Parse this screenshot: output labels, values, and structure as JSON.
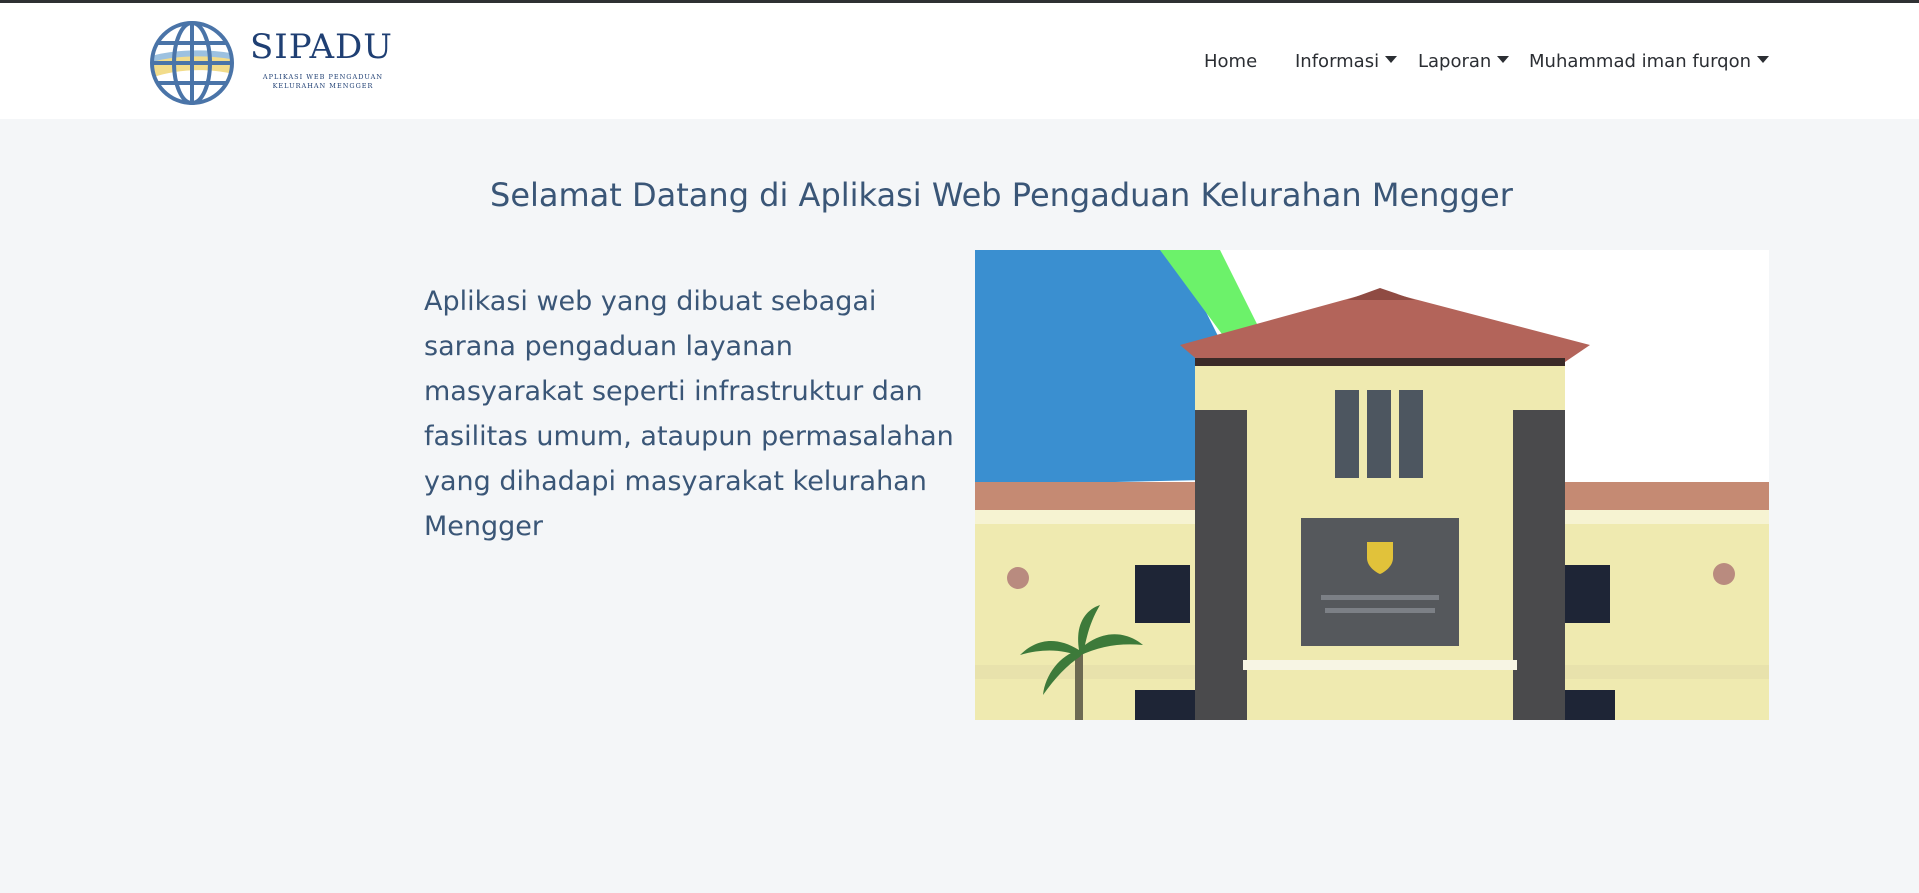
{
  "brand": {
    "title": "SIPADU",
    "subtitle": "APLIKASI WEB PENGADUAN KELURAHAN MENGGER",
    "colors": {
      "primary": "#1f3f73",
      "globe": "#4a74a8",
      "accent": "#f2dc8a"
    }
  },
  "nav": {
    "items": [
      {
        "label": "Home",
        "has_dropdown": false
      },
      {
        "label": "Informasi",
        "has_dropdown": true
      },
      {
        "label": "Laporan",
        "has_dropdown": true
      },
      {
        "label": "Muhammad iman furqon",
        "has_dropdown": true
      }
    ]
  },
  "main": {
    "title": "Selamat Datang di Aplikasi Web Pengaduan Kelurahan Mengger",
    "description": "Aplikasi web yang dibuat sebagai sarana pengaduan layanan masyarakat seperti infrastruktur dan fasilitas umum, ataupun permasalahan yang dihadapi masyarakat kelurahan Mengger",
    "text_color": "#3a5677"
  },
  "hero_image": {
    "subject": "kantor-kelurahan-building"
  }
}
